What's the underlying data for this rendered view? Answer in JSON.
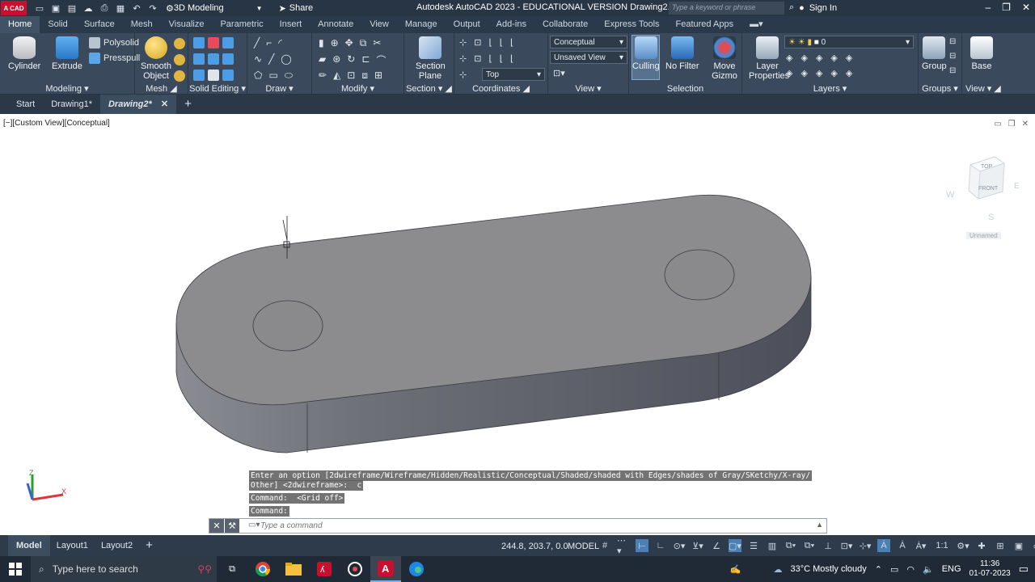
{
  "app": {
    "logo": "A CAD",
    "workspace": "3D Modeling",
    "share": "Share",
    "title": "Autodesk AutoCAD 2023 - EDUCATIONAL VERSION    Drawing2.dwg",
    "search_placeholder": "Type a keyword or phrase",
    "signin": "Sign In"
  },
  "ribbon_tabs": [
    "Home",
    "Solid",
    "Surface",
    "Mesh",
    "Visualize",
    "Parametric",
    "Insert",
    "Annotate",
    "View",
    "Manage",
    "Output",
    "Add-ins",
    "Collaborate",
    "Express Tools",
    "Featured Apps"
  ],
  "ribbon": {
    "modeling": {
      "title": "Modeling",
      "cylinder": "Cylinder",
      "extrude": "Extrude",
      "polysolid": "Polysolid",
      "presspull": "Presspull"
    },
    "mesh": {
      "title": "Mesh",
      "smooth": "Smooth Object"
    },
    "solid_editing": {
      "title": "Solid Editing"
    },
    "draw": {
      "title": "Draw"
    },
    "modify": {
      "title": "Modify"
    },
    "section": {
      "title": "Section",
      "section_plane": "Section Plane"
    },
    "coordinates": {
      "title": "Coordinates",
      "top": "Top"
    },
    "view": {
      "title": "View",
      "visual_style": "Conceptual",
      "saved_view": "Unsaved View"
    },
    "selection": {
      "title": "Selection",
      "culling": "Culling",
      "no_filter": "No Filter",
      "move_gizmo": "Move Gizmo"
    },
    "layers": {
      "title": "Layers",
      "layer_props": "Layer Properties",
      "current_layer": "0"
    },
    "groups": {
      "title": "Groups",
      "group": "Group"
    },
    "view2": {
      "title": "View",
      "base": "Base"
    }
  },
  "doc_tabs": [
    "Start",
    "Drawing1*",
    "Drawing2*"
  ],
  "viewport": {
    "label": "[−][Custom View][Conceptual]",
    "viewcube": {
      "top": "TOP",
      "front": "FRONT",
      "w": "W",
      "e": "E",
      "s": "S",
      "unnamed": "Unnamed"
    }
  },
  "command": {
    "hist1": "Enter an option [2dwireframe/Wireframe/Hidden/Realistic/Conceptual/Shaded/shaded with Edges/shades of Gray/SKetchy/X-ray/",
    "hist2": "Other] <2dwireframe>:  c",
    "hist3": "Command:  <Grid off>",
    "hist4": "Command:",
    "placeholder": "Type a command"
  },
  "status": {
    "layouts": [
      "Model",
      "Layout1",
      "Layout2"
    ],
    "coords": "244.8, 203.7, 0.0",
    "model": "MODEL",
    "scale": "1:1"
  },
  "taskbar": {
    "search": "Type here to search",
    "weather": "33°C  Mostly cloudy",
    "lang": "ENG",
    "time": "11:36",
    "date": "01-07-2023"
  }
}
